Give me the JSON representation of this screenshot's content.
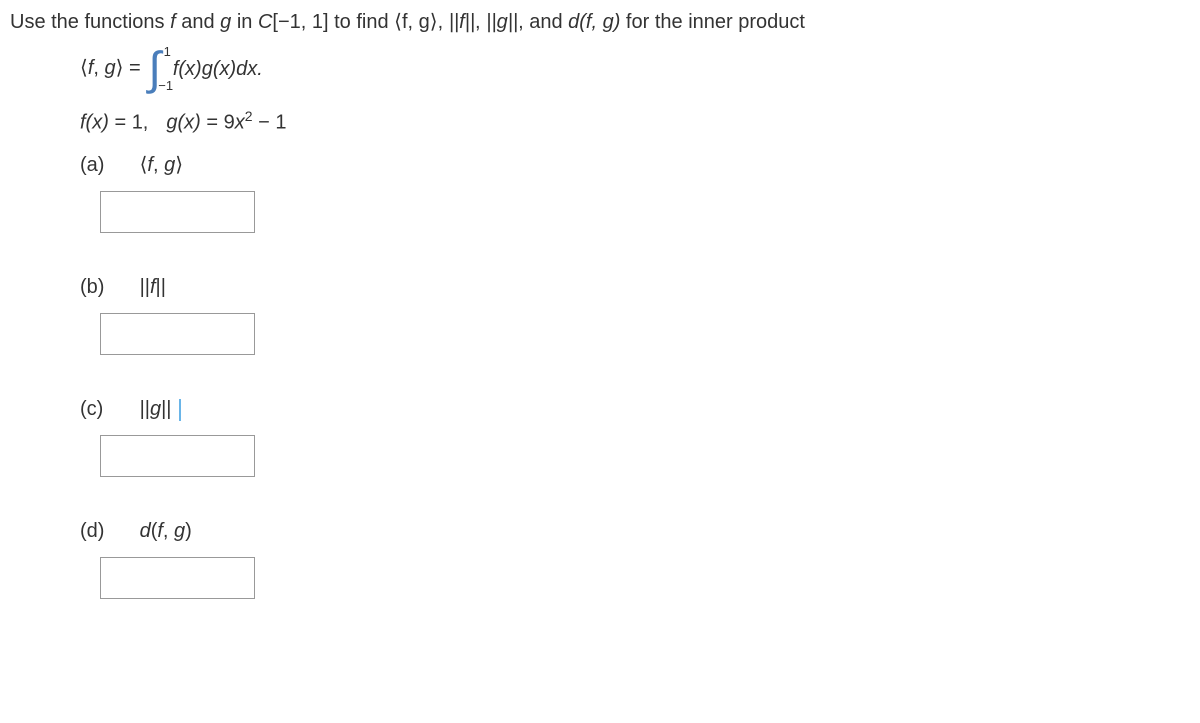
{
  "question": {
    "prefix": "Use the functions ",
    "f": "f",
    "and": " and ",
    "g": "g",
    "in_text": "  in ",
    "space": "C",
    "interval": "[−1, 1]",
    "tofind": " to find ",
    "fg": "⟨f, g⟩",
    "comma1": ", ",
    "normf": "||f||",
    "comma2": ", ",
    "normg": "||g||",
    "comma3": ", and ",
    "dfg": "d(f, g)",
    "for_inner": "  for the inner product"
  },
  "def": {
    "lhs_open": "⟨",
    "lhs_f": "f",
    "lhs_comma": ", ",
    "lhs_g": "g",
    "lhs_close": "⟩",
    "eq": " = ",
    "upper": "1",
    "lower": "−1",
    "integrand": "f(x)g(x)dx."
  },
  "funcs": {
    "fx": "f(x)",
    "eq1": " = ",
    "fval": "1,",
    "gx": "g(x)",
    "eq2": " = ",
    "coef": "9",
    "xvar": "x",
    "sq": "2",
    "minus": " − ",
    "one": "1"
  },
  "parts": {
    "a": {
      "label": "(a)",
      "open": "⟨",
      "f": "f",
      "comma": ", ",
      "g": "g",
      "close": "⟩"
    },
    "b": {
      "label": "(b)",
      "norm_l": "||",
      "f": "f",
      "norm_r": "||"
    },
    "c": {
      "label": "(c)",
      "norm_l": "||",
      "g": "g",
      "norm_r": "||"
    },
    "d": {
      "label": "(d)",
      "d": "d",
      "paren_l": "(",
      "f": "f",
      "comma": ", ",
      "g": "g",
      "paren_r": ")"
    }
  }
}
